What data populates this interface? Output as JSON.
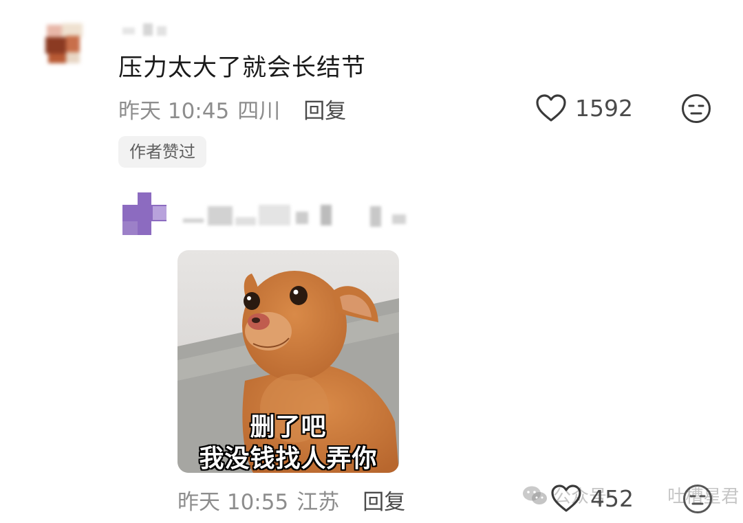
{
  "comment1": {
    "text": "压力太大了就会长结节",
    "time": "昨天 10:45",
    "location": "四川",
    "reply_label": "回复",
    "like_count": "1592",
    "author_badge": "作者赞过"
  },
  "comment2": {
    "meme": {
      "caption_line1": "删了吧",
      "caption_line2": "我没钱找人弄你"
    },
    "time": "昨天 10:55",
    "location": "江苏",
    "reply_label": "回复",
    "like_count": "452"
  },
  "watermark": {
    "account_type": "公众号",
    "separator": "·",
    "account_name": "吐槽星君"
  },
  "icons": {
    "like": "heart-outline-icon",
    "dislike": "unamused-face-icon",
    "watermark": "wechat-logo-icon"
  },
  "colors": {
    "text_primary": "#1a1a1a",
    "text_meta": "#8d8d8d",
    "reply": "#4a4a4a",
    "badge_bg": "#f2f2f2"
  }
}
